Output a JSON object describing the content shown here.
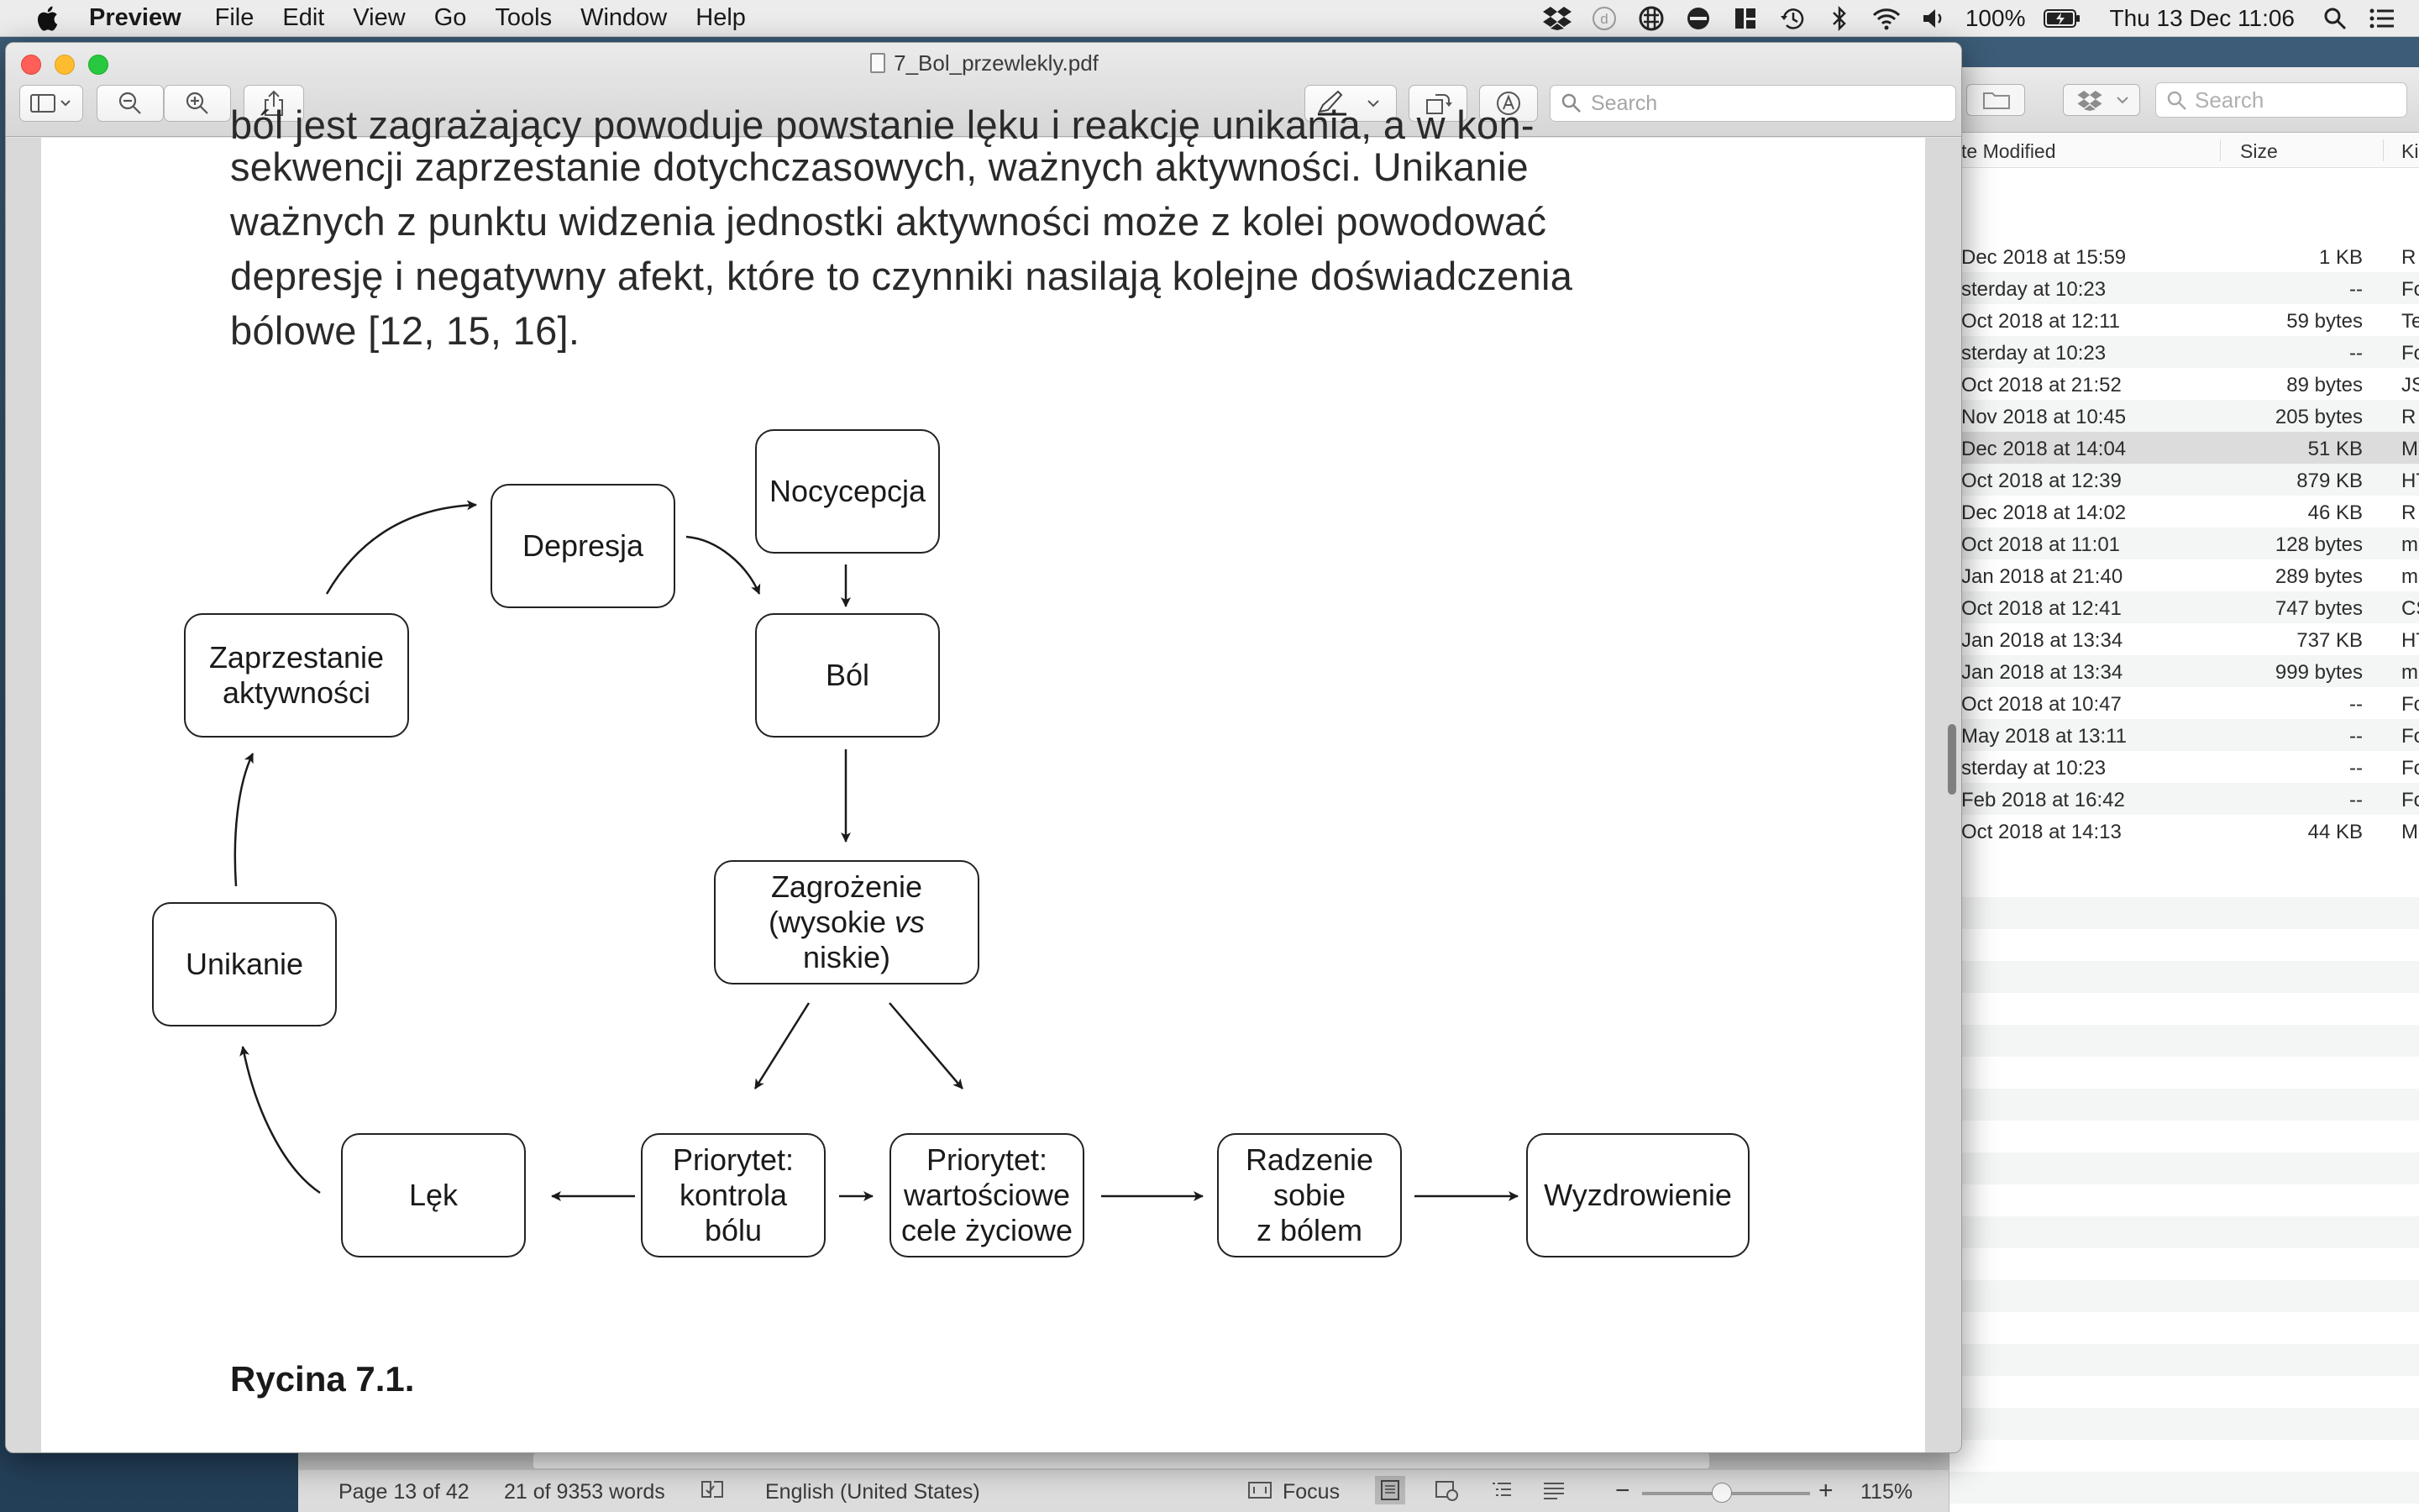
{
  "menubar": {
    "app": "Preview",
    "items": [
      "File",
      "Edit",
      "View",
      "Go",
      "Tools",
      "Window",
      "Help"
    ],
    "battery": "100%",
    "datetime": "Thu 13 Dec  11:06"
  },
  "preview": {
    "title": "7_Bol_przewlekly.pdf",
    "search_placeholder": "Search",
    "body_lines": [
      "sekwencji zaprzestanie dotychczasowych, ważnych aktywności. Unikanie",
      "ważnych z punktu widzenia jednostki aktywności może z kolei powodować",
      "depresję i negatywny afekt, które to czynniki nasilają kolejne doświadczenia",
      "bólowe [12, 15, 16]."
    ],
    "clipped_line": "ból jest zagrażający powoduje powstanie lęku i reakcję unikania, a w kon-",
    "diagram": {
      "nocycepcja": "Nocycepcja",
      "depresja": "Depresja",
      "bol": "Ból",
      "zaprzestanie_1": "Zaprzestanie",
      "zaprzestanie_2": "aktywności",
      "unikanie": "Unikanie",
      "zagrozenie_1": "Zagrożenie",
      "zagrozenie_2a": "(wysokie ",
      "zagrozenie_2b": "vs",
      "zagrozenie_3": "niskie)",
      "lek": "Lęk",
      "priorytet_kontrola_1": "Priorytet:",
      "priorytet_kontrola_2": "kontrola",
      "priorytet_kontrola_3": "bólu",
      "priorytet_wartosci_1": "Priorytet:",
      "priorytet_wartosci_2": "wartościowe",
      "priorytet_wartosci_3": "cele życiowe",
      "radzenie_1": "Radzenie",
      "radzenie_2": "sobie",
      "radzenie_3": "z bólem",
      "wyzdrowienie": "Wyzdrowienie"
    },
    "caption": "Rycina 7.1."
  },
  "finder": {
    "search_placeholder": "Search",
    "columns": [
      "te Modified",
      "Size",
      "Ki"
    ],
    "rows": [
      {
        "date": "Dec 2018 at 15:59",
        "size": "1 KB",
        "kind": "R"
      },
      {
        "date": "sterday at 10:23",
        "size": "--",
        "kind": "Fo"
      },
      {
        "date": "Oct 2018 at 12:11",
        "size": "59 bytes",
        "kind": "Te"
      },
      {
        "date": "sterday at 10:23",
        "size": "--",
        "kind": "Fo"
      },
      {
        "date": "Oct 2018 at 21:52",
        "size": "89 bytes",
        "kind": "JS"
      },
      {
        "date": "Nov 2018 at 10:45",
        "size": "205 bytes",
        "kind": "R"
      },
      {
        "date": "Dec 2018 at 14:04",
        "size": "51 KB",
        "kind": "Mi"
      },
      {
        "date": "Oct 2018 at 12:39",
        "size": "879 KB",
        "kind": "HT"
      },
      {
        "date": "Dec 2018 at 14:02",
        "size": "46 KB",
        "kind": "R"
      },
      {
        "date": "Oct 2018 at 11:01",
        "size": "128 bytes",
        "kind": "ma"
      },
      {
        "date": "Jan 2018 at 21:40",
        "size": "289 bytes",
        "kind": "ma"
      },
      {
        "date": "Oct 2018 at 12:41",
        "size": "747 bytes",
        "kind": "CS"
      },
      {
        "date": "Jan 2018 at 13:34",
        "size": "737 KB",
        "kind": "HT"
      },
      {
        "date": "Jan 2018 at 13:34",
        "size": "999 bytes",
        "kind": "ma"
      },
      {
        "date": "Oct 2018 at 10:47",
        "size": "--",
        "kind": "Fo"
      },
      {
        "date": "May 2018 at 13:11",
        "size": "--",
        "kind": "Fo"
      },
      {
        "date": "sterday at 10:23",
        "size": "--",
        "kind": "Fo"
      },
      {
        "date": "Feb 2018 at 16:42",
        "size": "--",
        "kind": "Fo"
      },
      {
        "date": "Oct 2018 at 14:13",
        "size": "44 KB",
        "kind": "Mi"
      }
    ],
    "selected_row": 6
  },
  "word_status": {
    "page": "Page 13 of 42",
    "words": "21 of 9353 words",
    "language": "English (United States)",
    "focus": "Focus",
    "zoom": "115%",
    "zoom_minus": "−",
    "zoom_plus": "+"
  },
  "colors": {
    "close": "#fe5f57",
    "minimize": "#febc2e",
    "maximize": "#28c840"
  }
}
